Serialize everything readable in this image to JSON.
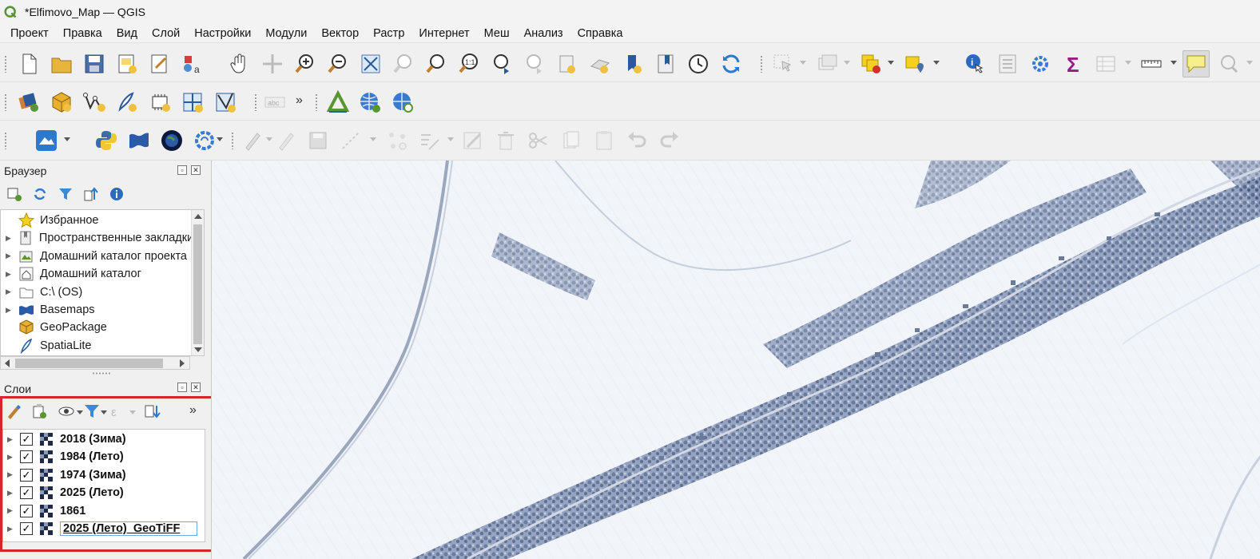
{
  "window": {
    "title": "*Elfimovo_Map — QGIS"
  },
  "menu": {
    "items": [
      "Проект",
      "Правка",
      "Вид",
      "Слой",
      "Настройки",
      "Модули",
      "Вектор",
      "Растр",
      "Интернет",
      "Меш",
      "Анализ",
      "Справка"
    ]
  },
  "toolbar_more": "»",
  "toolbar2_label_tool": "abc",
  "browser_panel": {
    "title": "Браузер",
    "items": [
      {
        "label": "Избранное",
        "icon": "star-icon",
        "expandable": false
      },
      {
        "label": "Пространственные закладки",
        "icon": "bookmark-icon",
        "expandable": true
      },
      {
        "label": "Домашний каталог проекта",
        "icon": "project-folder-icon",
        "expandable": true
      },
      {
        "label": "Домашний каталог",
        "icon": "home-icon",
        "expandable": true
      },
      {
        "label": "C:\\ (OS)",
        "icon": "folder-icon",
        "expandable": true
      },
      {
        "label": "Basemaps",
        "icon": "basemaps-icon",
        "expandable": true
      },
      {
        "label": "GeoPackage",
        "icon": "geopackage-icon",
        "expandable": false
      },
      {
        "label": "SpatiaLite",
        "icon": "spatialite-icon",
        "expandable": false
      }
    ]
  },
  "layers_panel": {
    "title": "Слои",
    "more": "»",
    "layers": [
      {
        "name": "2018 (Зима)",
        "checked": "✓"
      },
      {
        "name": "1984 (Лето)",
        "checked": "✓"
      },
      {
        "name": "1974 (Зима)",
        "checked": "✓"
      },
      {
        "name": "2025 (Лето)",
        "checked": "✓"
      },
      {
        "name": "1861",
        "checked": "✓"
      },
      {
        "name": "2025 (Лето)_GeoTiFF",
        "checked": "✓"
      }
    ]
  },
  "panel_controls": {
    "float": "▫",
    "close": "✕"
  },
  "colors": {
    "highlight_border": "#d9252b",
    "qgis_green": "#589632",
    "map_snow": "#eef2f8",
    "map_trees": "#5a6f95"
  }
}
